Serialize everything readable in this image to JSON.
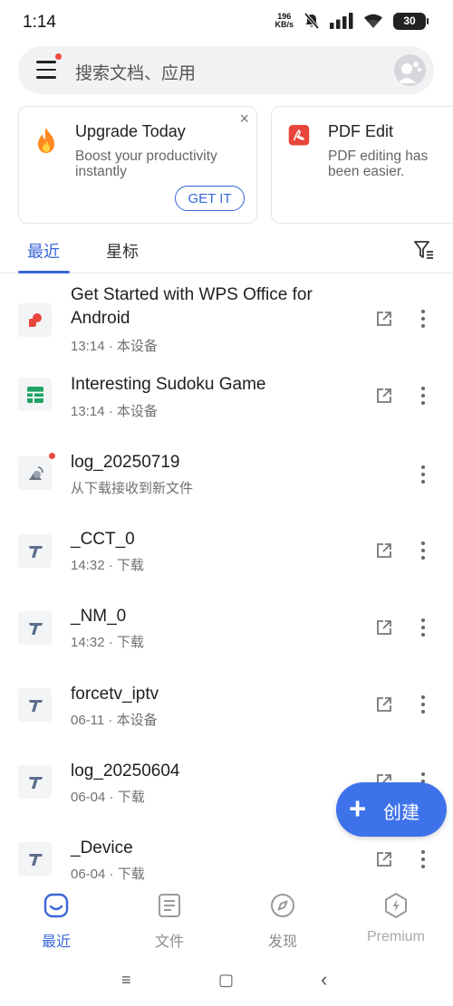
{
  "status": {
    "time": "1:14",
    "net_speed_value": "196",
    "net_speed_unit": "KB/s",
    "battery": "30"
  },
  "search": {
    "placeholder": "搜索文档、应用"
  },
  "promos": [
    {
      "title": "Upgrade Today",
      "desc": "Boost your productivity instantly",
      "button": "GET IT",
      "close": "×"
    },
    {
      "title": "PDF Edit",
      "desc": "PDF editing has been easier."
    }
  ],
  "tabs": {
    "recent": "最近",
    "starred": "星标"
  },
  "files": [
    {
      "name": "Get Started with WPS Office for Android",
      "meta": "13:14 · 本设备",
      "icon": "wps-doc-icon"
    },
    {
      "name": "Interesting Sudoku Game",
      "meta": "13:14 · 本设备",
      "icon": "spreadsheet-icon"
    },
    {
      "name": "log_20250719",
      "meta": "从下载接收到新文件",
      "icon": "download-receive-icon"
    },
    {
      "name": "_CCT_0",
      "meta": "14:32 · 下载",
      "icon": "text-file-icon"
    },
    {
      "name": "_NM_0",
      "meta": "14:32 · 下载",
      "icon": "text-file-icon"
    },
    {
      "name": "forcetv_iptv",
      "meta": "06-11 · 本设备",
      "icon": "text-file-icon"
    },
    {
      "name": "log_20250604",
      "meta": "06-04 · 下载",
      "icon": "text-file-icon"
    },
    {
      "name": "_Device",
      "meta": "06-04 · 下载",
      "icon": "text-file-icon"
    }
  ],
  "fab": {
    "plus": "+",
    "label": "创建"
  },
  "bottom_nav": [
    {
      "label": "最近",
      "icon": "recent-icon"
    },
    {
      "label": "文件",
      "icon": "files-icon"
    },
    {
      "label": "发现",
      "icon": "compass-icon"
    },
    {
      "label": "Premium",
      "icon": "premium-icon"
    }
  ],
  "system_nav": {
    "recents": "≡",
    "home": "▢",
    "back": "‹"
  },
  "colors": {
    "accent": "#3a66d8",
    "fab": "#3e72ea",
    "notification_dot": "#ef4a3e"
  }
}
